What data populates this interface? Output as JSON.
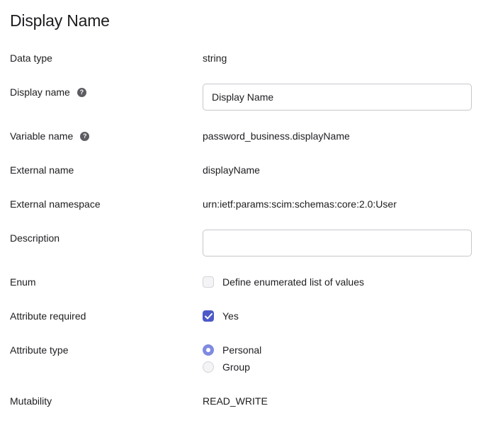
{
  "page": {
    "title": "Display Name"
  },
  "fields": {
    "data_type": {
      "label": "Data type",
      "value": "string"
    },
    "display_name": {
      "label": "Display name",
      "value": "Display Name",
      "help_icon": "question-circle-icon"
    },
    "variable_name": {
      "label": "Variable name",
      "value": "password_business.displayName",
      "help_icon": "question-circle-icon"
    },
    "external_name": {
      "label": "External name",
      "value": "displayName"
    },
    "external_namespace": {
      "label": "External namespace",
      "value": "urn:ietf:params:scim:schemas:core:2.0:User"
    },
    "description": {
      "label": "Description",
      "value": ""
    },
    "enum": {
      "label": "Enum",
      "option_label": "Define enumerated list of values",
      "checked": false
    },
    "attribute_required": {
      "label": "Attribute required",
      "option_label": "Yes",
      "checked": true
    },
    "attribute_type": {
      "label": "Attribute type",
      "options": [
        {
          "label": "Personal",
          "selected": true
        },
        {
          "label": "Group",
          "selected": false
        }
      ]
    },
    "mutability": {
      "label": "Mutability",
      "value": "READ_WRITE"
    }
  },
  "colors": {
    "accent": "#4d5ac8",
    "radio_selected": "#7f8ae0",
    "help_icon": "#5c5c62"
  }
}
